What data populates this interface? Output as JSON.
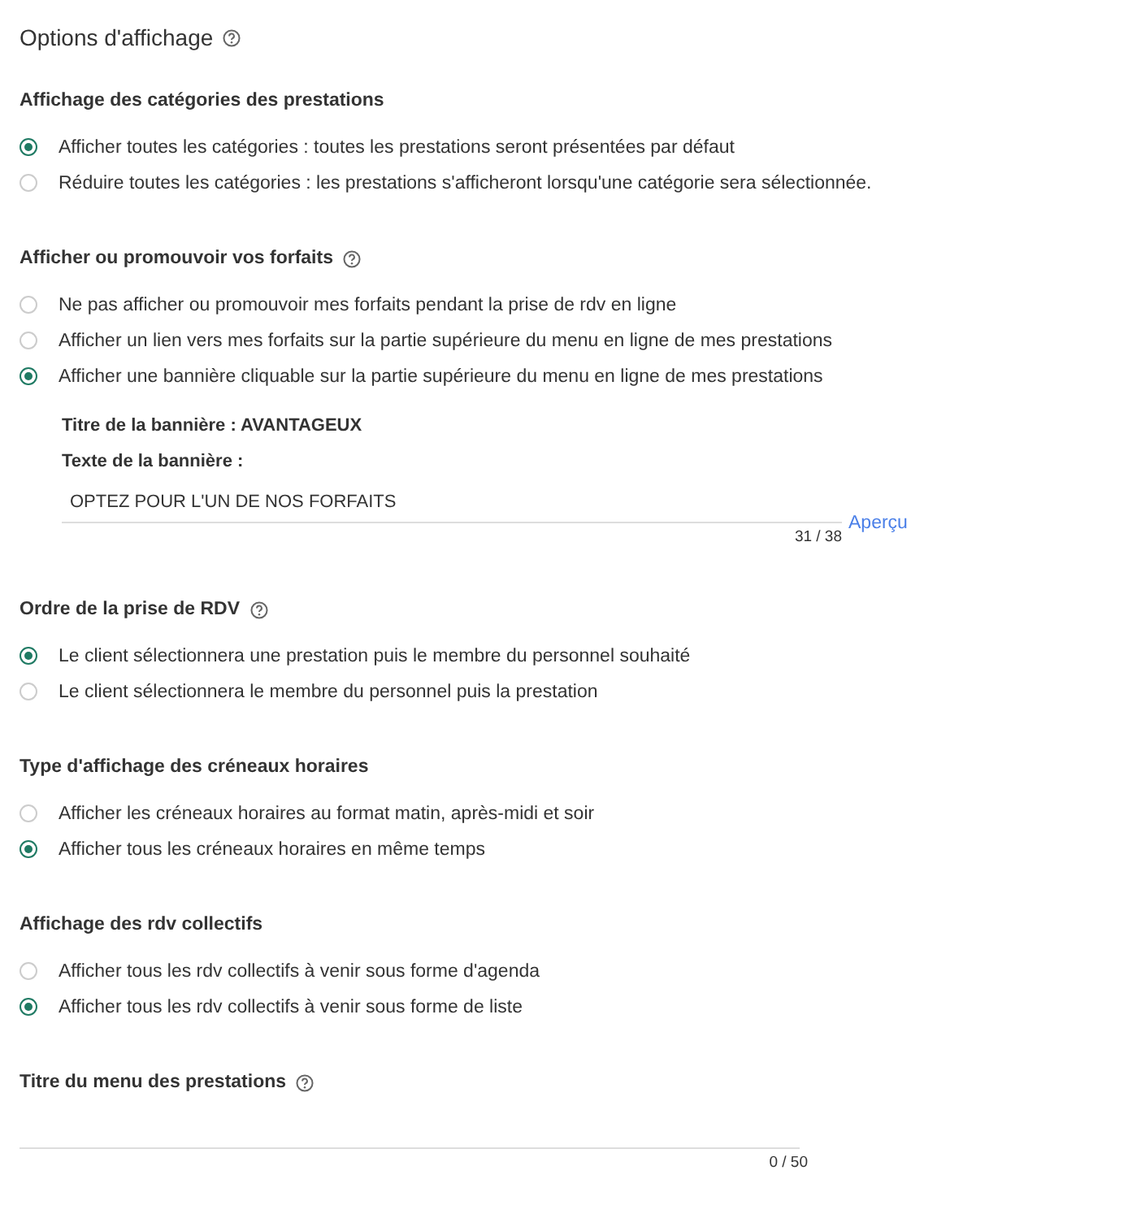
{
  "title": "Options d'affichage",
  "title_help": true,
  "sections": [
    {
      "title": "Affichage des catégories des prestations",
      "help": false,
      "options": [
        {
          "label": "Afficher toutes les catégories : toutes les prestations seront présentées par défaut",
          "selected": true
        },
        {
          "label": "Réduire toutes les catégories : les prestations s'afficheront lorsqu'une catégorie sera sélectionnée.",
          "selected": false
        }
      ]
    },
    {
      "title": "Afficher ou promouvoir vos forfaits",
      "help": true,
      "options": [
        {
          "label": "Ne pas afficher ou promouvoir mes forfaits pendant la prise de rdv en ligne",
          "selected": false
        },
        {
          "label": "Afficher un lien vers mes forfaits sur la partie supérieure du menu en ligne de mes prestations",
          "selected": false
        },
        {
          "label": "Afficher une bannière cliquable sur la partie supérieure du menu en ligne de mes prestations",
          "selected": true
        }
      ],
      "banner": {
        "title_line": "Titre de la bannière : AVANTAGEUX",
        "text_label": "Texte de la bannière :",
        "value": "OPTEZ POUR L'UN DE NOS FORFAITS",
        "counter": "31 / 38",
        "preview": "Aperçu"
      }
    },
    {
      "title": "Ordre de la prise de RDV",
      "help": true,
      "options": [
        {
          "label": "Le client sélectionnera une prestation puis le membre du personnel souhaité",
          "selected": true
        },
        {
          "label": "Le client sélectionnera le membre du personnel puis la prestation",
          "selected": false
        }
      ]
    },
    {
      "title": "Type d'affichage des créneaux horaires",
      "help": false,
      "options": [
        {
          "label": "Afficher les créneaux horaires au format matin, après-midi et soir",
          "selected": false
        },
        {
          "label": "Afficher tous les créneaux horaires en même temps",
          "selected": true
        }
      ]
    },
    {
      "title": "Affichage des rdv collectifs",
      "help": false,
      "options": [
        {
          "label": "Afficher tous les rdv collectifs à venir sous forme d'agenda",
          "selected": false
        },
        {
          "label": "Afficher tous les rdv collectifs à venir sous forme de liste",
          "selected": true
        }
      ]
    },
    {
      "title": "Titre du menu des prestations",
      "help": true,
      "field": {
        "counter": "0 / 50"
      }
    }
  ]
}
